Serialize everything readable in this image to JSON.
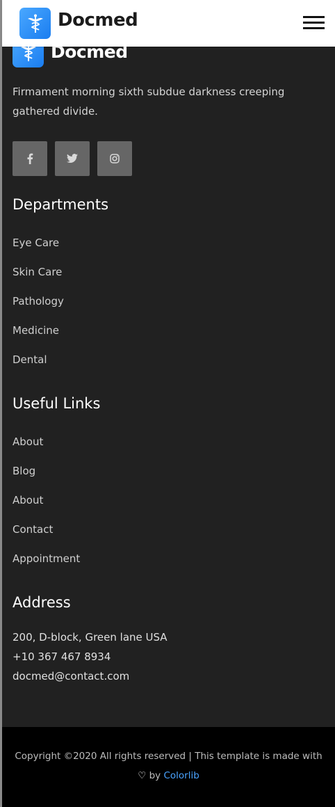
{
  "header": {
    "brand": "Docmed",
    "menu_icon": "hamburger-menu-icon"
  },
  "footer": {
    "brand": "Docmed",
    "description": "Firmament morning sixth subdue darkness creeping gathered divide.",
    "socials": [
      {
        "icon": "facebook-icon",
        "glyph": "f"
      },
      {
        "icon": "twitter-icon",
        "glyph": "twitter"
      },
      {
        "icon": "instagram-icon",
        "glyph": "instagram"
      }
    ],
    "departments": {
      "title": "Departments",
      "items": [
        "Eye Care",
        "Skin Care",
        "Pathology",
        "Medicine",
        "Dental"
      ]
    },
    "useful_links": {
      "title": "Useful Links",
      "items": [
        "About",
        "Blog",
        "About",
        "Contact",
        "Appointment"
      ]
    },
    "address": {
      "title": "Address",
      "line1": "200, D-block, Green lane USA",
      "phone": "+10 367 467 8934",
      "email": "docmed@contact.com"
    }
  },
  "copyright": {
    "text": "Copyright ©2020 All rights reserved | This template is made with",
    "heart": "♡",
    "by": "by",
    "credit": "Colorlib"
  },
  "colors": {
    "accent": "#1a7df0",
    "footer_bg": "#212121",
    "copyright_bg": "#000000",
    "link": "#4aa3ff"
  }
}
